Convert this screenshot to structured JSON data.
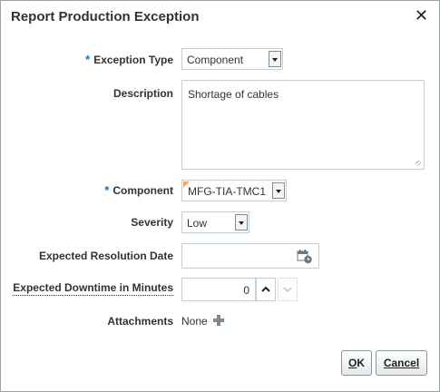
{
  "dialog": {
    "title": "Report Production Exception",
    "close_glyph": "✕"
  },
  "form": {
    "required_mark": "*",
    "exception_type": {
      "label": "Exception Type",
      "value": "Component"
    },
    "description": {
      "label": "Description",
      "value": "Shortage of cables"
    },
    "component": {
      "label": "Component",
      "value": "MFG-TIA-TMC1"
    },
    "severity": {
      "label": "Severity",
      "value": "Low"
    },
    "expected_resolution_date": {
      "label": "Expected Resolution Date",
      "value": "",
      "icon": "calendar-icon"
    },
    "expected_downtime": {
      "label": "Expected Downtime in Minutes",
      "value": "0"
    },
    "attachments": {
      "label": "Attachments",
      "value": "None",
      "icon": "add-icon"
    }
  },
  "buttons": {
    "ok": {
      "mnemonic": "O",
      "rest": "K"
    },
    "cancel": {
      "mnemonic": "C",
      "rest": "ancel"
    }
  },
  "colors": {
    "required": "#0572ce",
    "changed_flag": "#f2a86b",
    "border": "#c4ced7"
  }
}
